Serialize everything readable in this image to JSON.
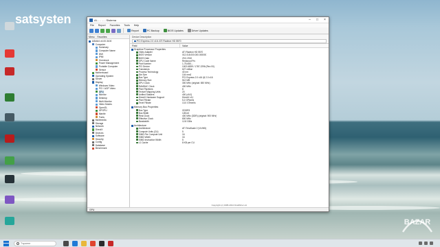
{
  "desktop": {
    "brand_text": "satsysten",
    "watermark": "BAZAR",
    "icons": [
      {
        "name": "icon-1",
        "label": "",
        "color": "#cfd8dc"
      },
      {
        "name": "icon-2",
        "label": "",
        "color": "#e53935"
      },
      {
        "name": "icon-3",
        "label": "",
        "color": "#c62828"
      },
      {
        "name": "icon-4",
        "label": "",
        "color": "#2e7d32"
      },
      {
        "name": "icon-5",
        "label": "",
        "color": "#455a64"
      },
      {
        "name": "icon-6",
        "label": "",
        "color": "#b71c1c"
      },
      {
        "name": "icon-7",
        "label": "",
        "color": "#43a047"
      },
      {
        "name": "icon-8",
        "label": "",
        "color": "#263238"
      },
      {
        "name": "icon-9",
        "label": "",
        "color": "#7e57c2"
      },
      {
        "name": "icon-10",
        "label": "",
        "color": "#26a69a"
      }
    ]
  },
  "window": {
    "title": "AI... - ... - Sistema",
    "menu": [
      "File",
      "Report",
      "Favorites",
      "Tools",
      "Help"
    ],
    "toolbar": {
      "report": "Report",
      "pc_backup": "PC Backup",
      "bios_updates": "BIOS Updates",
      "driver_updates": "Driver Updates"
    },
    "tabs": [
      "Menu",
      "Favorites"
    ],
    "tree": [
      {
        "label": "AIDA64 v4.00.3100",
        "indent": 0,
        "color": "#1f5faa"
      },
      {
        "label": "Computer",
        "indent": 1,
        "color": "#4a7fbf"
      },
      {
        "label": "Summary",
        "indent": 2,
        "color": "#5b9bd5"
      },
      {
        "label": "Computer Name",
        "indent": 2,
        "color": "#5b9bd5"
      },
      {
        "label": "DMI",
        "indent": 2,
        "color": "#5b9bd5"
      },
      {
        "label": "IPMI",
        "indent": 2,
        "color": "#5b9bd5"
      },
      {
        "label": "Overclock",
        "indent": 2,
        "color": "#d08a2f"
      },
      {
        "label": "Power Management",
        "indent": 2,
        "color": "#3c8f3c"
      },
      {
        "label": "Portable Computer",
        "indent": 2,
        "color": "#5b9bd5"
      },
      {
        "label": "Sensor",
        "indent": 2,
        "color": "#d04a2f"
      },
      {
        "label": "Motherboard",
        "indent": 1,
        "color": "#3c8f3c"
      },
      {
        "label": "Operating System",
        "indent": 1,
        "color": "#1f5faa"
      },
      {
        "label": "Server",
        "indent": 1,
        "color": "#6b6b6b"
      },
      {
        "label": "Display",
        "indent": 1,
        "color": "#1f5faa"
      },
      {
        "label": "Windows Video",
        "indent": 2,
        "color": "#5b9bd5"
      },
      {
        "label": "PCI / AGP Video",
        "indent": 2,
        "color": "#5b9bd5"
      },
      {
        "label": "GPU",
        "indent": 2,
        "color": "#3c8f3c",
        "selected": true
      },
      {
        "label": "Monitor",
        "indent": 2,
        "color": "#5b9bd5"
      },
      {
        "label": "Desktop",
        "indent": 2,
        "color": "#5b9bd5"
      },
      {
        "label": "Multi-Monitor",
        "indent": 2,
        "color": "#5b9bd5"
      },
      {
        "label": "Video Modes",
        "indent": 2,
        "color": "#5b9bd5"
      },
      {
        "label": "OpenGL",
        "indent": 2,
        "color": "#d04a2f"
      },
      {
        "label": "GPGPU",
        "indent": 2,
        "color": "#3c8f3c"
      },
      {
        "label": "Mantle",
        "indent": 2,
        "color": "#d04a2f"
      },
      {
        "label": "Fonts",
        "indent": 2,
        "color": "#d08a2f"
      },
      {
        "label": "Multimedia",
        "indent": 1,
        "color": "#6b6b6b"
      },
      {
        "label": "Storage",
        "indent": 1,
        "color": "#6b6b6b"
      },
      {
        "label": "Network",
        "indent": 1,
        "color": "#1f5faa"
      },
      {
        "label": "DirectX",
        "indent": 1,
        "color": "#3c8f3c"
      },
      {
        "label": "Devices",
        "indent": 1,
        "color": "#6b6b6b"
      },
      {
        "label": "Software",
        "indent": 1,
        "color": "#1f5faa"
      },
      {
        "label": "Security",
        "indent": 1,
        "color": "#d08a2f"
      },
      {
        "label": "Config",
        "indent": 1,
        "color": "#6b6b6b"
      },
      {
        "label": "Database",
        "indent": 1,
        "color": "#6b6b6b"
      },
      {
        "label": "Benchmark",
        "indent": 1,
        "color": "#d04a2f"
      }
    ],
    "device_description_label": "Device Description",
    "device_description_value": "PCI Express 2.0 x16: ATI Radeon HD 5570",
    "columns": {
      "field": "Field",
      "value": "Value"
    },
    "groups": [
      {
        "title": "Graphics Processor Properties",
        "rows": [
          {
            "field": "Video Adapter",
            "value": "ATI Radeon HD 5570"
          },
          {
            "field": "BIOS Version",
            "value": "012.018.000.000.000000"
          },
          {
            "field": "BIOS Date",
            "value": "29.0.2010"
          },
          {
            "field": "GPU Code Name",
            "value": "Redwood Pro"
          },
          {
            "field": "Part Number",
            "value": "1-75-650-..."
          },
          {
            "field": "PCI Device",
            "value": "1002-68D9 / 1787-2296 (Rev 00)"
          },
          {
            "field": "Transistors",
            "value": "627 million"
          },
          {
            "field": "Process Technology",
            "value": "40 nm"
          },
          {
            "field": "Die Size",
            "value": "104 mm2"
          },
          {
            "field": "Bus Type",
            "value": "PCI Express 2.0 x16 @ 2.0 x16"
          },
          {
            "field": "Memory Size",
            "value": "512 MB"
          },
          {
            "field": "GPU Clock",
            "value": "300 MHz (original: 650 MHz)"
          },
          {
            "field": "RAMDAC Clock",
            "value": "400 MHz"
          },
          {
            "field": "Pixel Pipelines",
            "value": "8"
          },
          {
            "field": "Texture Mapping Units",
            "value": "20"
          },
          {
            "field": "Unified Shaders",
            "value": "400 (v5.0)"
          },
          {
            "field": "DirectX Hardware Support",
            "value": "DirectX v11"
          },
          {
            "field": "Pixel Fillrate",
            "value": "5.2 GPixel/s"
          },
          {
            "field": "Texel Fillrate",
            "value": "13.0 GTexel/s"
          }
        ]
      },
      {
        "title": "Memory Bus Properties",
        "rows": [
          {
            "field": "Bus Type",
            "value": "GDDR3"
          },
          {
            "field": "Bus Width",
            "value": "128-bit"
          },
          {
            "field": "Real Clock",
            "value": "400 MHz (DDR) (original: 900 MHz)"
          },
          {
            "field": "Effective Clock",
            "value": "800 MHz"
          },
          {
            "field": "Bandwidth",
            "value": "12.8 GB/s"
          }
        ]
      },
      {
        "title": "Architecture",
        "rows": [
          {
            "field": "Architecture",
            "value": "ATI TeraScale 2 (VLIW5)"
          },
          {
            "field": "Compute Units (CU)",
            "value": "5"
          },
          {
            "field": "SIMD Per Compute Unit",
            "value": "16"
          },
          {
            "field": "SIMD Width",
            "value": "16"
          },
          {
            "field": "SIMD Instruction Width",
            "value": "5"
          },
          {
            "field": "L1 Cache",
            "value": "8 KB per CU"
          }
        ]
      }
    ],
    "copyright": "Copyright (c) 1995-2014 FinalWire Ltd.",
    "status_left": "GPU"
  },
  "taskbar": {
    "search_placeholder": "Търсене",
    "time": "",
    "date": ""
  }
}
